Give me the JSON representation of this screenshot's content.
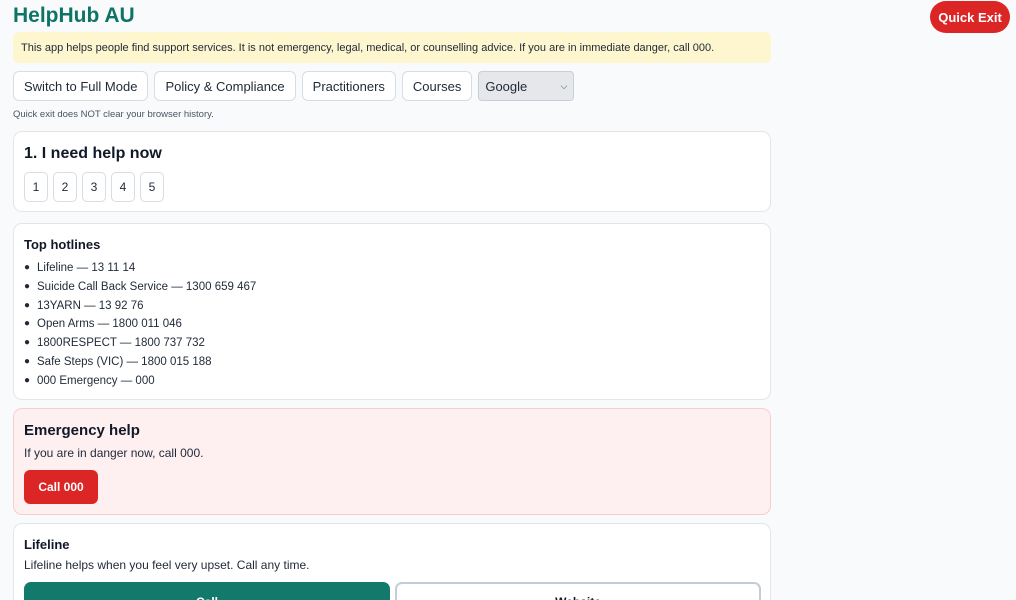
{
  "header": {
    "title": "HelpHub AU",
    "quick_exit_label": "Quick Exit"
  },
  "disclaimer": "This app helps people find support services. It is not emergency, legal, medical, or counselling advice. If you are in immediate danger, call 000.",
  "toolbar": {
    "buttons": [
      "Switch to Full Mode",
      "Policy & Compliance",
      "Practitioners",
      "Courses"
    ],
    "search_engine_selected": "Google"
  },
  "exit_note": "Quick exit does NOT clear your browser history.",
  "help_now": {
    "title": "1. I need help now",
    "steps": [
      "1",
      "2",
      "3",
      "4",
      "5"
    ]
  },
  "hotlines": {
    "title": "Top hotlines",
    "items": [
      "Lifeline — 13 11 14",
      "Suicide Call Back Service — 1300 659 467",
      "13YARN — 13 92 76",
      "Open Arms — 1800 011 046",
      "1800RESPECT — 1800 737 732",
      "Safe Steps (VIC) — 1800 015 188",
      "000 Emergency — 000"
    ]
  },
  "emergency": {
    "title": "Emergency help",
    "text": "If you are in danger now, call 000.",
    "button_label": "Call 000"
  },
  "lifeline": {
    "title": "Lifeline",
    "text": "Lifeline helps when you feel very upset. Call any time.",
    "call_label": "Call",
    "website_label": "Website"
  },
  "colors": {
    "brand": "#0f7466",
    "danger": "#dc2626",
    "notice_bg": "#fdf6cf",
    "emergency_bg": "#fef0f0"
  }
}
